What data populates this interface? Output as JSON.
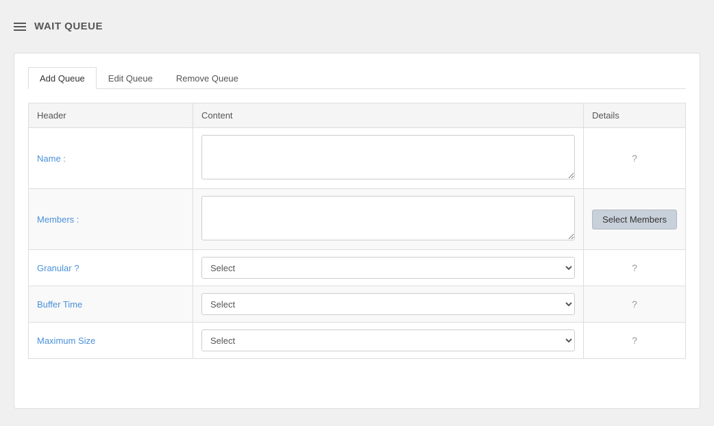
{
  "page": {
    "title": "WAIT QUEUE"
  },
  "tabs": [
    {
      "id": "add-queue",
      "label": "Add Queue",
      "active": true
    },
    {
      "id": "edit-queue",
      "label": "Edit Queue",
      "active": false
    },
    {
      "id": "remove-queue",
      "label": "Remove Queue",
      "active": false
    }
  ],
  "table": {
    "columns": {
      "header": "Header",
      "content": "Content",
      "details": "Details"
    },
    "rows": [
      {
        "id": "name",
        "label": "Name :",
        "type": "textarea",
        "value": "",
        "placeholder": "",
        "details": "?",
        "details_button": null
      },
      {
        "id": "members",
        "label": "Members :",
        "type": "textarea",
        "value": "",
        "placeholder": "",
        "details": null,
        "details_button": "Select Members"
      },
      {
        "id": "granular",
        "label": "Granular ?",
        "type": "select",
        "options": [
          "Select"
        ],
        "details": "?"
      },
      {
        "id": "buffer-time",
        "label": "Buffer Time",
        "type": "select",
        "options": [
          "Select"
        ],
        "details": "?"
      },
      {
        "id": "maximum-size",
        "label": "Maximum Size",
        "type": "select",
        "options": [
          "Select"
        ],
        "details": "?"
      }
    ]
  }
}
